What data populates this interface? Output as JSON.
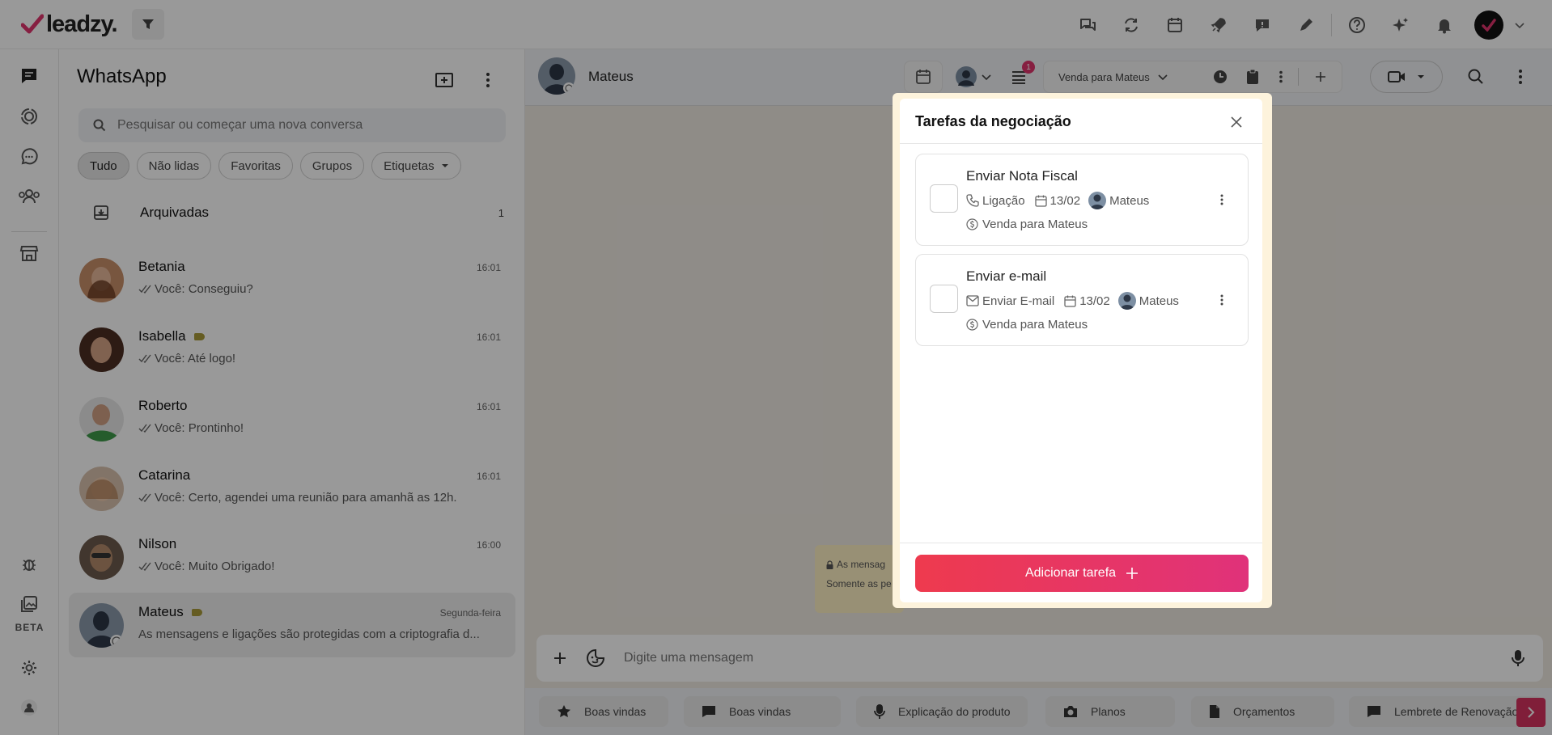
{
  "app": {
    "logo_text": "leadzy."
  },
  "top_icons": [
    "chat-bubbles-icon",
    "sync-icon",
    "calendar-icon",
    "rocket-icon",
    "message-alert-icon",
    "pen-icon",
    "help-icon",
    "sparkles-icon",
    "bell-icon",
    "user-avatar",
    "chevron-down-icon"
  ],
  "rail": {
    "beta_label": "BETA"
  },
  "panel": {
    "title": "WhatsApp",
    "search_placeholder": "Pesquisar ou começar uma nova conversa",
    "filters": [
      "Tudo",
      "Não lidas",
      "Favoritas",
      "Grupos",
      "Etiquetas"
    ],
    "archived": {
      "label": "Arquivadas",
      "count": "1"
    },
    "chats": [
      {
        "name": "Betania",
        "time": "16:01",
        "preview": "Você: Conseguiu?",
        "tag": false,
        "avatar_color": "#a86b4b"
      },
      {
        "name": "Isabella",
        "time": "16:01",
        "preview": "Você: Até logo!",
        "tag": true,
        "avatar_color": "#6e4433"
      },
      {
        "name": "Roberto",
        "time": "16:01",
        "preview": "Você: Prontinho!",
        "tag": false,
        "avatar_color": "#3f7a45"
      },
      {
        "name": "Catarina",
        "time": "16:01",
        "preview": "Você: Certo, agendei uma reunião para amanhã as 12h.",
        "tag": false,
        "avatar_color": "#b89274"
      },
      {
        "name": "Nilson",
        "time": "16:00",
        "preview": "Você: Muito Obrigado!",
        "tag": false,
        "avatar_color": "#5a4a3d"
      },
      {
        "name": "Mateus",
        "time": "Segunda-feira",
        "preview": "As mensagens e ligações são protegidas com a criptografia d...",
        "tag": true,
        "avatar_color": "#4a5a70"
      }
    ]
  },
  "conversation": {
    "contact_name": "Mateus",
    "deal_name": "Venda para Mateus",
    "notification_count": "1",
    "e2e_note_line1": "As mensag",
    "e2e_note_line2": "Somente as pe",
    "message_placeholder": "Digite uma mensagem",
    "quick_replies": [
      {
        "label": "Boas vindas",
        "icon": "star-icon"
      },
      {
        "label": "Boas vindas",
        "icon": "chat-icon"
      },
      {
        "label": "Explicação do produto",
        "icon": "mic-icon"
      },
      {
        "label": "Planos",
        "icon": "camera-icon"
      },
      {
        "label": "Orçamentos",
        "icon": "document-icon"
      },
      {
        "label": "Lembrete de Renovação d",
        "icon": "chat-icon"
      }
    ]
  },
  "modal": {
    "title": "Tarefas da negociação",
    "tasks": [
      {
        "title": "Enviar Nota Fiscal",
        "type": "Ligação",
        "date": "13/02",
        "owner": "Mateus",
        "deal": "Venda para Mateus"
      },
      {
        "title": "Enviar e-mail",
        "type": "Enviar E-mail",
        "date": "13/02",
        "owner": "Mateus",
        "deal": "Venda para Mateus"
      }
    ],
    "add_button_label": "Adicionar tarefa"
  },
  "colors": {
    "brand_red": "#e0356d",
    "accent_gradient_start": "#ee3a4e",
    "accent_gradient_end": "#e0327a"
  }
}
